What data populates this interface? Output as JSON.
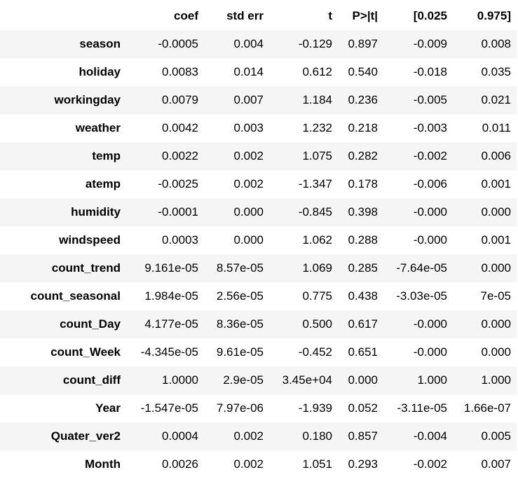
{
  "table": {
    "header_stub": "",
    "columns": [
      "coef",
      "std err",
      "t",
      "P>|t|",
      "[0.025",
      "0.975]"
    ],
    "rows": [
      {
        "name": "season",
        "cells": [
          "-0.0005",
          "0.004",
          "-0.129",
          "0.897",
          "-0.009",
          "0.008"
        ]
      },
      {
        "name": "holiday",
        "cells": [
          "0.0083",
          "0.014",
          "0.612",
          "0.540",
          "-0.018",
          "0.035"
        ]
      },
      {
        "name": "workingday",
        "cells": [
          "0.0079",
          "0.007",
          "1.184",
          "0.236",
          "-0.005",
          "0.021"
        ]
      },
      {
        "name": "weather",
        "cells": [
          "0.0042",
          "0.003",
          "1.232",
          "0.218",
          "-0.003",
          "0.011"
        ]
      },
      {
        "name": "temp",
        "cells": [
          "0.0022",
          "0.002",
          "1.075",
          "0.282",
          "-0.002",
          "0.006"
        ]
      },
      {
        "name": "atemp",
        "cells": [
          "-0.0025",
          "0.002",
          "-1.347",
          "0.178",
          "-0.006",
          "0.001"
        ]
      },
      {
        "name": "humidity",
        "cells": [
          "-0.0001",
          "0.000",
          "-0.845",
          "0.398",
          "-0.000",
          "0.000"
        ]
      },
      {
        "name": "windspeed",
        "cells": [
          "0.0003",
          "0.000",
          "1.062",
          "0.288",
          "-0.000",
          "0.001"
        ]
      },
      {
        "name": "count_trend",
        "cells": [
          "9.161e-05",
          "8.57e-05",
          "1.069",
          "0.285",
          "-7.64e-05",
          "0.000"
        ]
      },
      {
        "name": "count_seasonal",
        "cells": [
          "1.984e-05",
          "2.56e-05",
          "0.775",
          "0.438",
          "-3.03e-05",
          "7e-05"
        ]
      },
      {
        "name": "count_Day",
        "cells": [
          "4.177e-05",
          "8.36e-05",
          "0.500",
          "0.617",
          "-0.000",
          "0.000"
        ]
      },
      {
        "name": "count_Week",
        "cells": [
          "-4.345e-05",
          "9.61e-05",
          "-0.452",
          "0.651",
          "-0.000",
          "0.000"
        ]
      },
      {
        "name": "count_diff",
        "cells": [
          "1.0000",
          "2.9e-05",
          "3.45e+04",
          "0.000",
          "1.000",
          "1.000"
        ]
      },
      {
        "name": "Year",
        "cells": [
          "-1.547e-05",
          "7.97e-06",
          "-1.939",
          "0.052",
          "-3.11e-05",
          "1.66e-07"
        ]
      },
      {
        "name": "Quater_ver2",
        "cells": [
          "0.0004",
          "0.002",
          "0.180",
          "0.857",
          "-0.004",
          "0.005"
        ]
      },
      {
        "name": "Month",
        "cells": [
          "0.0026",
          "0.002",
          "1.051",
          "0.293",
          "-0.002",
          "0.007"
        ]
      }
    ]
  }
}
